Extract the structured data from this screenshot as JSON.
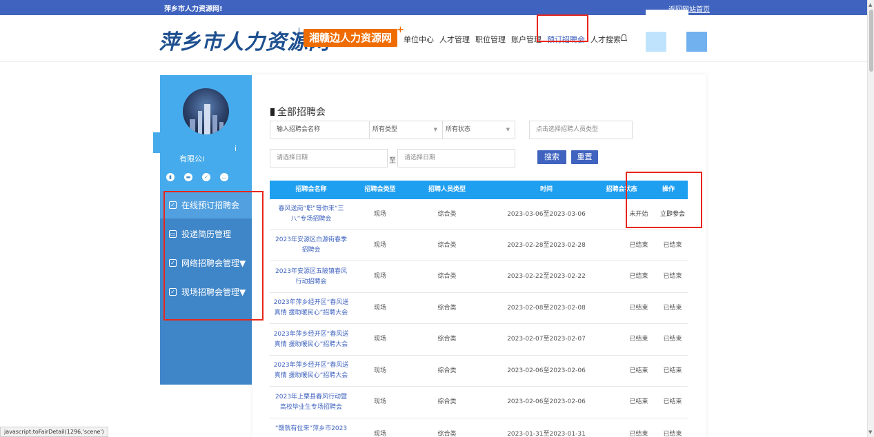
{
  "topbar": {
    "welcome": "萍乡市人力资源网!",
    "home_link": "返回网站首页"
  },
  "header": {
    "logo_text": "萍乡市人力资源网",
    "logo_badge": "湘赣边人力资源网",
    "logo_plus": "+",
    "nav_items": [
      {
        "label": "单位中心"
      },
      {
        "label": "人才管理"
      },
      {
        "label": "职位管理"
      },
      {
        "label": "账户管理"
      },
      {
        "label": "预订招聘会"
      },
      {
        "label": "人才搜索"
      }
    ],
    "bell_icon": "bell-icon",
    "colors": {
      "active_nav": "#3f63bf",
      "highlight": "#e8261a"
    }
  },
  "sidebar": {
    "company_name": "有限公i",
    "company_extra": "i",
    "badges": [
      "icon-1",
      "icon-2",
      "icon-3",
      "icon-4"
    ],
    "menu": [
      {
        "label": "在线预订招聘会",
        "icon": "edit-icon",
        "active": true
      },
      {
        "label": "投递简历管理",
        "icon": "briefcase-icon",
        "active": false
      },
      {
        "label": "网络招聘会管理▼",
        "icon": "edit-icon",
        "active": false
      },
      {
        "label": "现场招聘会管理▼",
        "icon": "edit-icon",
        "active": false
      }
    ]
  },
  "main": {
    "title": "全部招聘会",
    "filters": {
      "name_placeholder": "输入招聘会名称",
      "type_value": "所有类型",
      "status_value": "所有状态",
      "person_type_placeholder": "点击选择招聘人员类型",
      "date_start_placeholder": "请选择日期",
      "date_to": "至",
      "date_end_placeholder": "请选择日期",
      "search_label": "搜索",
      "reset_label": "重置"
    },
    "table": {
      "headers": [
        "招聘会名称",
        "招聘会类型",
        "招聘人员类型",
        "时间",
        "招聘会状态",
        "操作"
      ],
      "rows": [
        {
          "name": "春风送岗“职”等你来“三八”专场招聘会",
          "type": "现场",
          "person": "综合类",
          "time": "2023-03-06至2023-03-06",
          "status": "未开始",
          "op": "立即参会"
        },
        {
          "name": "2023年安源区白源街春季招聘会",
          "type": "现场",
          "person": "综合类",
          "time": "2023-02-28至2023-02-28",
          "status": "已结束",
          "op": "已结束"
        },
        {
          "name": "2023年安源区五陂镇春风行动招聘会",
          "type": "现场",
          "person": "综合类",
          "time": "2023-02-22至2023-02-22",
          "status": "已结束",
          "op": "已结束"
        },
        {
          "name": "2023年萍乡经开区“春风送真情 援助暖民心”招聘大会",
          "type": "现场",
          "person": "综合类",
          "time": "2023-02-08至2023-02-08",
          "status": "已结束",
          "op": "已结束"
        },
        {
          "name": "2023年萍乡经开区“春风送真情 援助暖民心”招聘大会",
          "type": "现场",
          "person": "综合类",
          "time": "2023-02-07至2023-02-07",
          "status": "已结束",
          "op": "已结束"
        },
        {
          "name": "2023年萍乡经开区“春风送真情 援助暖民心”招聘大会",
          "type": "现场",
          "person": "综合类",
          "time": "2023-02-06至2023-02-06",
          "status": "已结束",
          "op": "已结束"
        },
        {
          "name": "2023年上栗县春风行动暨高校毕业生专场招聘会",
          "type": "现场",
          "person": "综合类",
          "time": "2023-02-06至2023-02-06",
          "status": "已结束",
          "op": "已结束"
        },
        {
          "name": "“赣就有位来”萍乡市2023",
          "type": "现场",
          "person": "综合类",
          "time": "2023-01-31至2023-01-31",
          "status": "已结束",
          "op": "已结束"
        }
      ]
    }
  },
  "statusbar": {
    "text": "javascript:toFairDetail(1296,'scene')"
  }
}
